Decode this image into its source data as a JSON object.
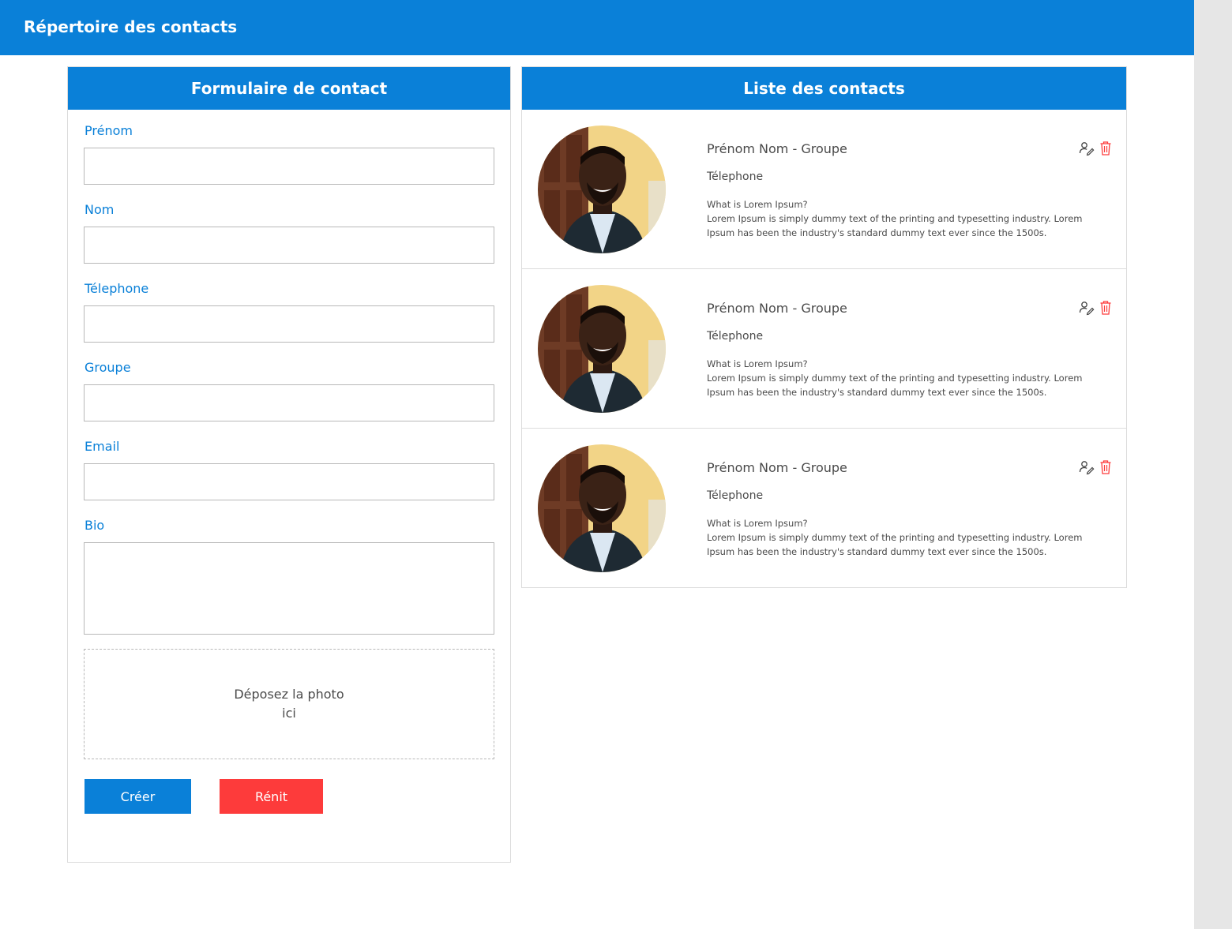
{
  "app": {
    "title": "Répertoire des contacts"
  },
  "colors": {
    "primary": "#0a80d8",
    "danger": "#fd3b3b",
    "label": "#0a80d8",
    "text": "#4a4a4a"
  },
  "form": {
    "title": "Formulaire de contact",
    "fields": {
      "firstname": {
        "label": "Prénom",
        "value": ""
      },
      "lastname": {
        "label": "Nom",
        "value": ""
      },
      "phone": {
        "label": "Télephone",
        "value": ""
      },
      "group": {
        "label": "Groupe",
        "value": ""
      },
      "email": {
        "label": "Email",
        "value": ""
      },
      "bio": {
        "label": "Bio",
        "value": ""
      }
    },
    "dropzone": "Déposez la photo ici",
    "create_label": "Créer",
    "reset_label": "Rénit"
  },
  "list": {
    "title": "Liste des contacts",
    "contacts": [
      {
        "name": "Prénom Nom - Groupe",
        "phone": "Télephone",
        "bio": " What is Lorem Ipsum?\nLorem Ipsum is simply dummy text of the printing and typesetting industry. Lorem Ipsum has been the industry's standard dummy text ever since the 1500s.",
        "avatar": "avatar-photo",
        "edit_icon": "user-edit-icon",
        "delete_icon": "trash-icon"
      },
      {
        "name": "Prénom Nom - Groupe",
        "phone": "Télephone",
        "bio": " What is Lorem Ipsum?\nLorem Ipsum is simply dummy text of the printing and typesetting industry. Lorem Ipsum has been the industry's standard dummy text ever since the 1500s.",
        "avatar": "avatar-photo",
        "edit_icon": "user-edit-icon",
        "delete_icon": "trash-icon"
      },
      {
        "name": "Prénom Nom - Groupe",
        "phone": "Télephone",
        "bio": " What is Lorem Ipsum?\nLorem Ipsum is simply dummy text of the printing and typesetting industry. Lorem Ipsum has been the industry's standard dummy text ever since the 1500s.",
        "avatar": "avatar-photo",
        "edit_icon": "user-edit-icon",
        "delete_icon": "trash-icon"
      }
    ]
  }
}
